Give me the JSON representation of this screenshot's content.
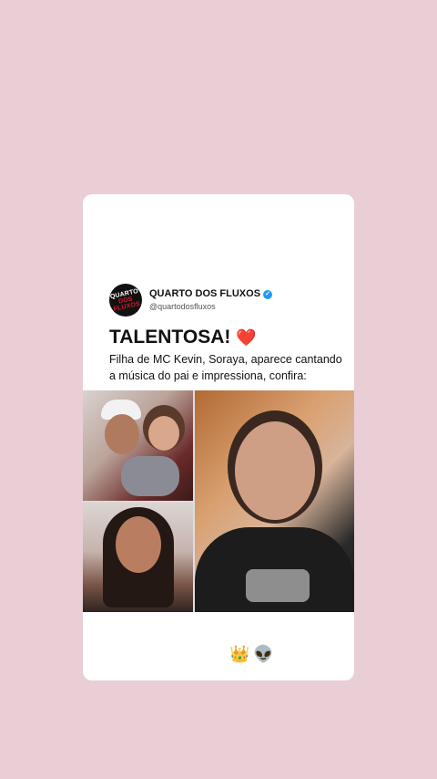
{
  "post": {
    "account_name": "QUARTO DOS FLUXOS",
    "handle": "@quartodosfluxos",
    "logo_text_top": "QUARTO",
    "logo_text_bottom": "DOS FLUXOS",
    "verified_icon": "checkmark",
    "headline": "TALENTOSA!",
    "headline_emoji": "❤️",
    "description": "Filha de MC Kevin, Soraya, aparece cantando a música do pai e impressiona, confira:"
  },
  "stickers": {
    "crown": "👑",
    "alien": "👽"
  },
  "colors": {
    "background": "#e9ced6",
    "card": "#ffffff",
    "verified": "#1d9bf0",
    "accent_red": "#e0152b"
  }
}
